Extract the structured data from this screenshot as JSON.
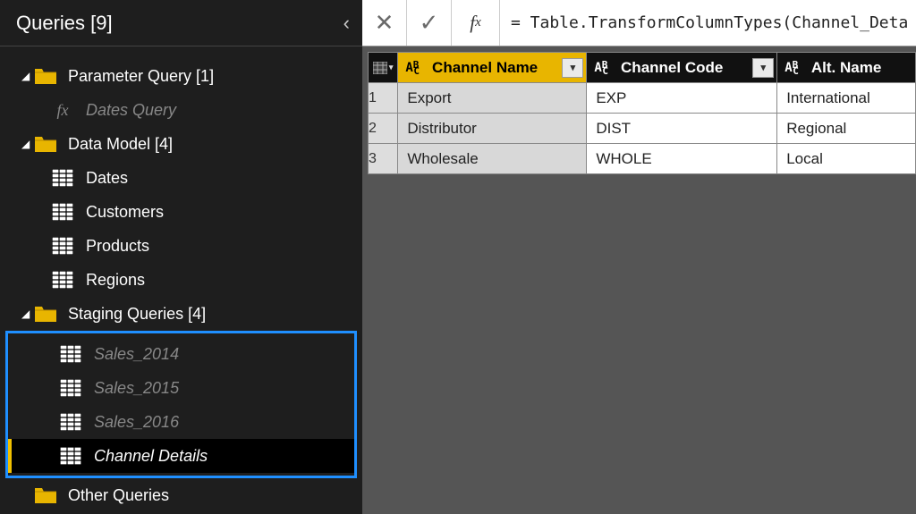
{
  "panel": {
    "title": "Queries [9]",
    "groups": {
      "parameter": "Parameter Query [1]",
      "dates_query": "Dates Query",
      "data_model": "Data Model [4]",
      "dates": "Dates",
      "customers": "Customers",
      "products": "Products",
      "regions": "Regions",
      "staging": "Staging Queries [4]",
      "sales_2014": "Sales_2014",
      "sales_2015": "Sales_2015",
      "sales_2016": "Sales_2016",
      "channel_details": "Channel Details",
      "other": "Other Queries"
    }
  },
  "formula": "= Table.TransformColumnTypes(Channel_Deta",
  "table": {
    "columns": [
      {
        "name": "Channel Name"
      },
      {
        "name": "Channel Code"
      },
      {
        "name": "Alt. Name"
      }
    ],
    "rows": [
      {
        "n": "1",
        "name": "Export",
        "code": "EXP",
        "alt": "International"
      },
      {
        "n": "2",
        "name": "Distributor",
        "code": "DIST",
        "alt": "Regional"
      },
      {
        "n": "3",
        "name": "Wholesale",
        "code": "WHOLE",
        "alt": "Local"
      }
    ]
  }
}
